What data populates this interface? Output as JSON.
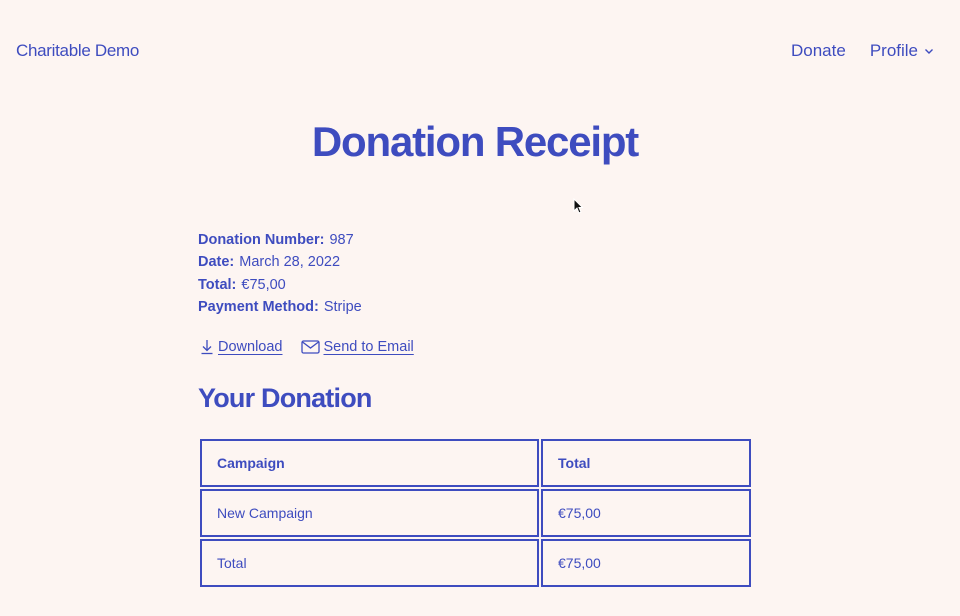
{
  "header": {
    "site_title": "Charitable Demo",
    "nav": {
      "donate": "Donate",
      "profile": "Profile"
    }
  },
  "page": {
    "title": "Donation Receipt"
  },
  "receipt": {
    "details": [
      {
        "label": "Donation Number:",
        "value": "987"
      },
      {
        "label": "Date:",
        "value": "March 28, 2022"
      },
      {
        "label": "Total:",
        "value": "€75,00"
      },
      {
        "label": "Payment Method:",
        "value": "Stripe"
      }
    ],
    "actions": {
      "download": "Download",
      "send_email": "Send to Email"
    }
  },
  "donation": {
    "title": "Your Donation",
    "columns": [
      "Campaign",
      "Total"
    ],
    "rows": [
      [
        "New Campaign",
        "€75,00"
      ],
      [
        "Total",
        "€75,00"
      ]
    ]
  },
  "colors": {
    "background": "#fdf5f2",
    "accent": "#3e4cbf"
  },
  "icons": {
    "download": "download-icon",
    "email": "email-icon",
    "profile_dropdown": "chevron-down-icon"
  }
}
